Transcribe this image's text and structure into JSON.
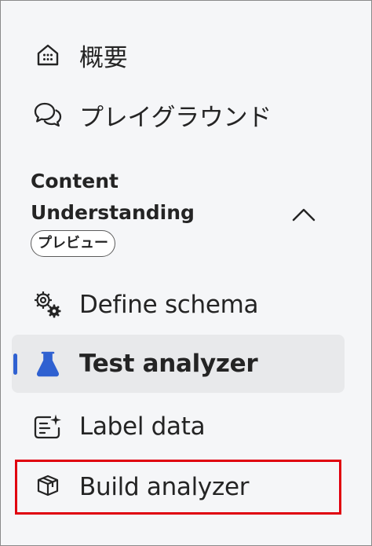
{
  "nav": {
    "overview_label": "概要",
    "playground_label": "プレイグラウンド",
    "section": {
      "title": "Content Understanding",
      "badge": "プレビュー",
      "state": "expanded"
    },
    "define_schema_label": "Define schema",
    "test_analyzer_label": "Test analyzer",
    "label_data_label": "Label data",
    "build_analyzer_label": "Build analyzer",
    "selected_item": "Test analyzer",
    "highlighted_item": "Build analyzer"
  },
  "icons": {
    "overview": "home-grid-icon",
    "playground": "chat-bubbles-icon",
    "collapse": "chevron-up-icon",
    "define_schema": "gear-settings-icon",
    "test_analyzer": "beaker-icon",
    "label_data": "text-sparkle-icon",
    "build_analyzer": "cube-icon"
  },
  "colors": {
    "selected_accent": "#2f61d1",
    "highlight_border": "#e0000f",
    "selected_background": "#e8e9eb",
    "panel_background": "#f5f6f8"
  }
}
